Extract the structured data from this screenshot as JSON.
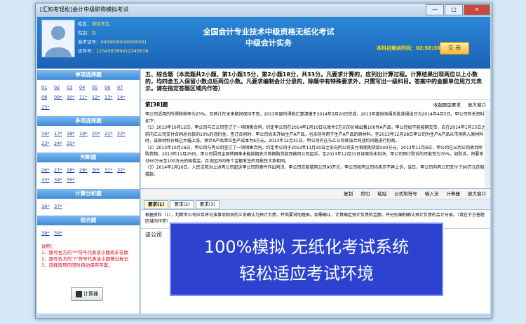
{
  "window": {
    "title": "[汇知考轻松]会计中级职称模拟考试",
    "minimize": "—",
    "maximize": "□",
    "close": "✕"
  },
  "candidate": {
    "name_label": "姓名：",
    "name": "测试考生",
    "gender_label": "性别：",
    "gender": "女",
    "ticket_label": "准考证号：",
    "ticket": "0409000040000001",
    "id_label": "证件号：",
    "id": "123456789012345678"
  },
  "exam": {
    "title_line1": "全国会计专业技术中级资格无纸化考试",
    "title_line2": "中级会计实务",
    "timer_label": "本科目剩余时间：",
    "timer_value": "02:58:30",
    "submit_label": "交 卷"
  },
  "sidebar": {
    "sections": [
      {
        "title": "单项选择题",
        "items": [
          "01",
          "02",
          "03",
          "04",
          "05",
          "06",
          "07",
          "08",
          "09*",
          "10*",
          "11*",
          "12*",
          "13*",
          "14*",
          "15*"
        ]
      },
      {
        "title": "多项选择题",
        "items": [
          "16*",
          "17*",
          "18*",
          "19*",
          "20*",
          "21*",
          "22*",
          "23*",
          "24*",
          "25*"
        ]
      },
      {
        "title": "判断题",
        "items": [
          "26*",
          "27*",
          "28*",
          "29*",
          "30*",
          "31*",
          "32*",
          "33*",
          "34*",
          "35*"
        ]
      },
      {
        "title": "计算分析题",
        "items": [
          "36*",
          "37*"
        ]
      },
      {
        "title": "综合题",
        "items": [
          "38*",
          "39*"
        ]
      }
    ],
    "legend": [
      "说明：",
      "1、题号右方的\"*\"符号代表该小题尚未答题",
      "2、题号右方的\"?\"符号代表该小题做过标记",
      "3、选择选项的同时自动保存答案。"
    ],
    "calculator_label": "计算器"
  },
  "question": {
    "instructions": "五、综合题（本类题共2小题，第1小题15分，第2小题18分，共33分。凡要求计算的，应列出计算过程。计算结果出现两位以上小数的，均四舍五入保留小数点后两位小数。凡要求编制会计分录的，除题中有特殊要求外，只需写出一级科目。答案中的金额单位用万元表示。请在指定答题区域内作答）",
    "number": "第[38]题",
    "tools": [
      "收起题型要求",
      "放大窗口"
    ],
    "stem": [
      "甲公司适用的所得税税率为25%，且预计在未来期间保持不变，2013年度所得税汇算清缴于2014年3月20日完成，2013年度财务报告批准报出日为2014年4月5日。甲公司有关资料如下：",
      "（1）2013年10月12日，甲公司与乙公司签订了一项销售合同，约定甲公司在2014年1月10日以每件5万元的价格出售100件A产品，甲公司如不能按期交货，应在2014年1月15日之前向乙公司支付合同总价款的10%的违约金。签订合同时，甲公司尚未开始生产A产品，也未持有用于生产A产品的原材料。至2013年12月28日甲公司为生产A产品从市场购入原材料时，该原材料价格已大幅上涨，预计A产品单位生产成本为6万元。2013年12月31日，甲公司仍在与乙公司就该合同违约问题进行协商。",
      "（2）2013年10月16日，甲公司与丙公司签订了一项销售合同，约定甲公司于2013年11月20日之前向丙公司支付首期购货款500万元。2013年11月8日，甲公司已从丙公司收到所购货物。2013年11月25日，甲公司因资金周转困难未能按期支付首期购货款而被丙公司起诉，至2013年12月31日该案尚未判决，甲公司预计败诉的可能性为70%，如败诉，将要支付60万元至100万元的赔偿金，且该区间内每个金额发生的可能性大致相同。",
      "（3）2014年1月26日，人民法院对上述丙公司起诉甲公司的案件作出判决，甲公司应赔偿丙公司90万元，甲公司和丙公司均表示不再上诉，当日，甲公司向丙公司支付了90万元的赔偿款。"
    ],
    "edit_tools": [
      "复制",
      "剪切",
      "粘贴",
      "公式和符号",
      "输入法",
      "计算器",
      "放大窗口"
    ],
    "tabs": [
      "要求(1)",
      "要求(2)",
      "要求(3)"
    ],
    "requirement": "根据资料（1），判断甲公司应否将与该事项相关的义务确认为预计负债，并简要说明理由。如需确认，计算确定预计负债的金额，并分别编制确认预计负债的会计分录。（请在下方答题区域内作答）",
    "answer": "该公司"
  },
  "banner": {
    "line1": "100%模拟 无纸化考试系统",
    "line2": "轻松适应考试环境"
  }
}
